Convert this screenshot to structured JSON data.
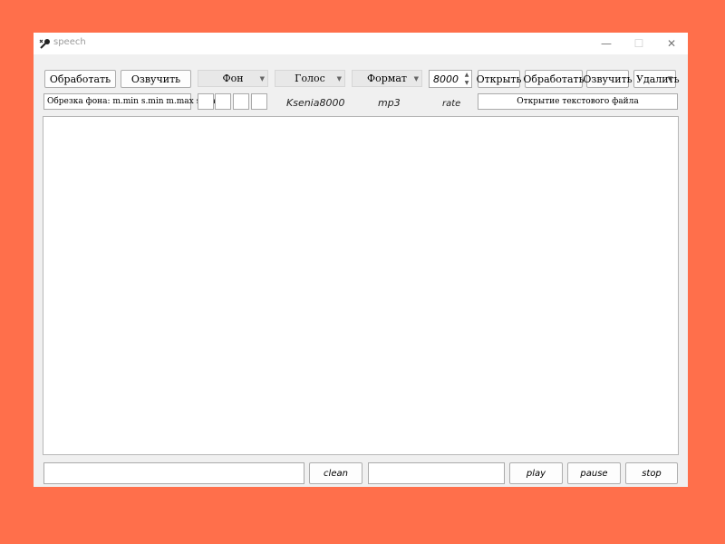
{
  "window": {
    "title": "speech",
    "minimize": "—",
    "maximize": "☐",
    "close": "✕"
  },
  "toolbar": {
    "process_label": "Обработать",
    "speak_label": "Озвучить",
    "background_combo": "Фон",
    "voice_combo": "Голос",
    "format_combo": "Формат",
    "rate_value": "8000",
    "open_label": "Открыть",
    "process2_label": "Обработать",
    "speak2_label": "Озвучить",
    "delete_combo": "Удалить"
  },
  "second_row": {
    "trim_field": "Обрезка фона: m.min s.min m.max s.max",
    "voice_name": "Ksenia8000",
    "format_value": "mp3",
    "rate_label": "rate",
    "status_field": "Открытие текстового файла"
  },
  "bottom": {
    "clean_label": "clean",
    "play_label": "play",
    "pause_label": "pause",
    "stop_label": "stop"
  },
  "icons": {
    "app": "microphone-icon",
    "combo_arrow": "chevron-down-icon"
  }
}
